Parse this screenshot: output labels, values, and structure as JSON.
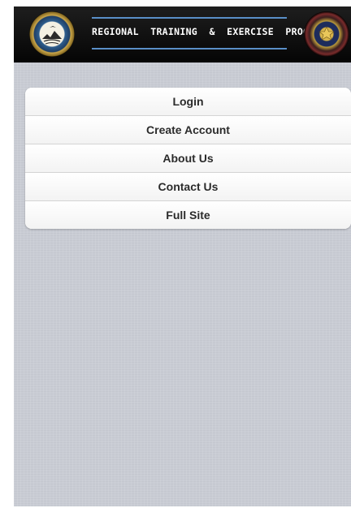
{
  "header": {
    "title": "REGIONAL  TRAINING  &  EXERCISE  PROGRAM",
    "left_logo_icon": "regional-seal-icon",
    "right_logo_icon": "sheriff-badge-seal-icon"
  },
  "menu": {
    "items": [
      {
        "label": "Login"
      },
      {
        "label": "Create Account"
      },
      {
        "label": "About Us"
      },
      {
        "label": "Contact Us"
      },
      {
        "label": "Full Site"
      }
    ]
  },
  "colors": {
    "header_bg": "#0a0a0a",
    "header_accent": "#5a8fc8",
    "page_bg": "#c9ccd4",
    "menu_text": "#2b2b2b"
  }
}
